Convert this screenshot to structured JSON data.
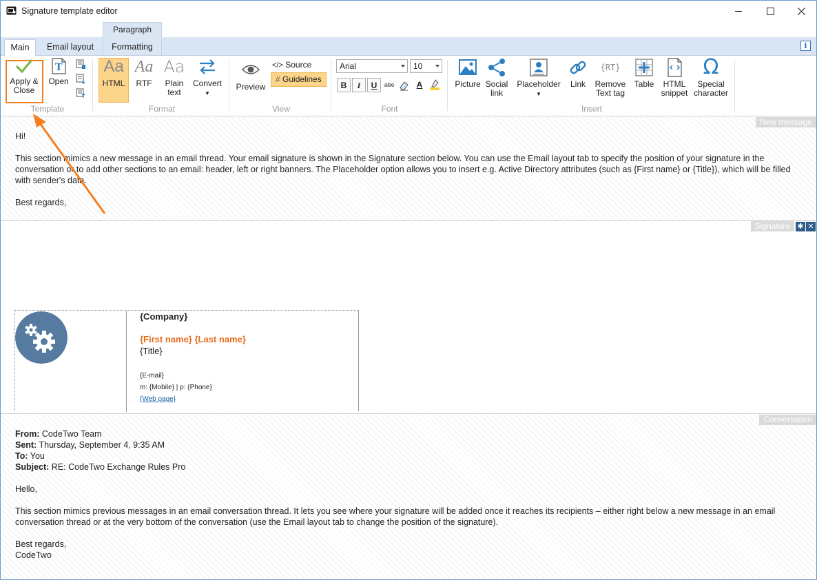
{
  "window": {
    "title": "Signature template editor"
  },
  "tabs": {
    "contextual": "Paragraph",
    "items": [
      "Main",
      "Email layout",
      "Formatting"
    ],
    "active": "Main",
    "info_label": "i"
  },
  "ribbon": {
    "template": {
      "label": "Template",
      "apply_close_line1": "Apply &",
      "apply_close_line2": "Close",
      "open": "Open"
    },
    "format": {
      "label": "Format",
      "html": "HTML",
      "rtf": "RTF",
      "plain_line1": "Plain",
      "plain_line2": "text",
      "convert": "Convert",
      "aa_glyph": "Aa"
    },
    "view": {
      "label": "View",
      "preview": "Preview",
      "source": "Source",
      "source_glyph": "</>",
      "guidelines": "Guidelines",
      "guidelines_glyph": "#"
    },
    "font": {
      "label": "Font",
      "family": "Arial",
      "size": "10",
      "bold": "B",
      "italic": "I",
      "underline": "U",
      "strike": "abc",
      "color": "A"
    },
    "insert": {
      "label": "Insert",
      "picture": "Picture",
      "social_line1": "Social",
      "social_line2": "link",
      "placeholder": "Placeholder",
      "link": "Link",
      "remove_line1": "Remove",
      "remove_line2": "Text tag",
      "rt_glyph": "RT",
      "table": "Table",
      "html_line1": "HTML",
      "html_line2": "snippet",
      "special_line1": "Special",
      "special_line2": "character",
      "omega_glyph": "Ω"
    }
  },
  "new_message": {
    "label": "New message",
    "greeting": "Hi!",
    "paragraph": "This section mimics a new message in an email thread. Your email signature is shown in the Signature section below. You can use the Email layout tab to specify the position of your signature in the conversation or to add other sections to an email: header, left or right banners. The Placeholder option allows you to insert e.g. Active Directory attributes (such as {First name} or {Title}), which will be filled with sender's data.",
    "closing": "Best regards,"
  },
  "signature": {
    "label": "Signature",
    "company": "{Company}",
    "name": "{First name} {Last name}",
    "title": "{Title}",
    "email": "{E-mail}",
    "phones": "m:  {Mobile} | p: {Phone}",
    "web": "{Web page}"
  },
  "conversation": {
    "label": "Conversation",
    "from_label": "From:",
    "from_value": " CodeTwo Team",
    "sent_label": "Sent:",
    "sent_value": " Thursday, September 4, 9:35 AM",
    "to_label": "To:",
    "to_value": " You",
    "subject_label": "Subject:",
    "subject_value": " RE: CodeTwo Exchange Rules Pro",
    "greeting": "Hello,",
    "paragraph": "This section mimics previous messages in an email conversation thread. It lets you see where your signature will be added once it reaches its recipients – either right below a new message in an email conversation thread or at the very bottom of the conversation (use the Email layout tab to change the position of the signature).",
    "closing1": "Best regards,",
    "closing2": "CodeTwo"
  },
  "colors": {
    "accent_orange": "#f38020",
    "icon_blue": "#2c7fc3",
    "highlight": "#fcd48a",
    "name_orange": "#e86d1c",
    "logo_blue": "#567aa0"
  },
  "icons": [
    "app-icon",
    "minimize-icon",
    "maximize-icon",
    "close-icon",
    "checkmark-icon",
    "open-template-icon",
    "eye-icon",
    "source-icon",
    "grid-icon",
    "picture-icon",
    "share-icon",
    "placeholder-icon",
    "link-icon",
    "rt-icon",
    "table-icon",
    "html-snippet-icon",
    "omega-icon",
    "gear-icon",
    "close-section-icon",
    "gears-logo-icon",
    "arrow-annotation-icon"
  ]
}
